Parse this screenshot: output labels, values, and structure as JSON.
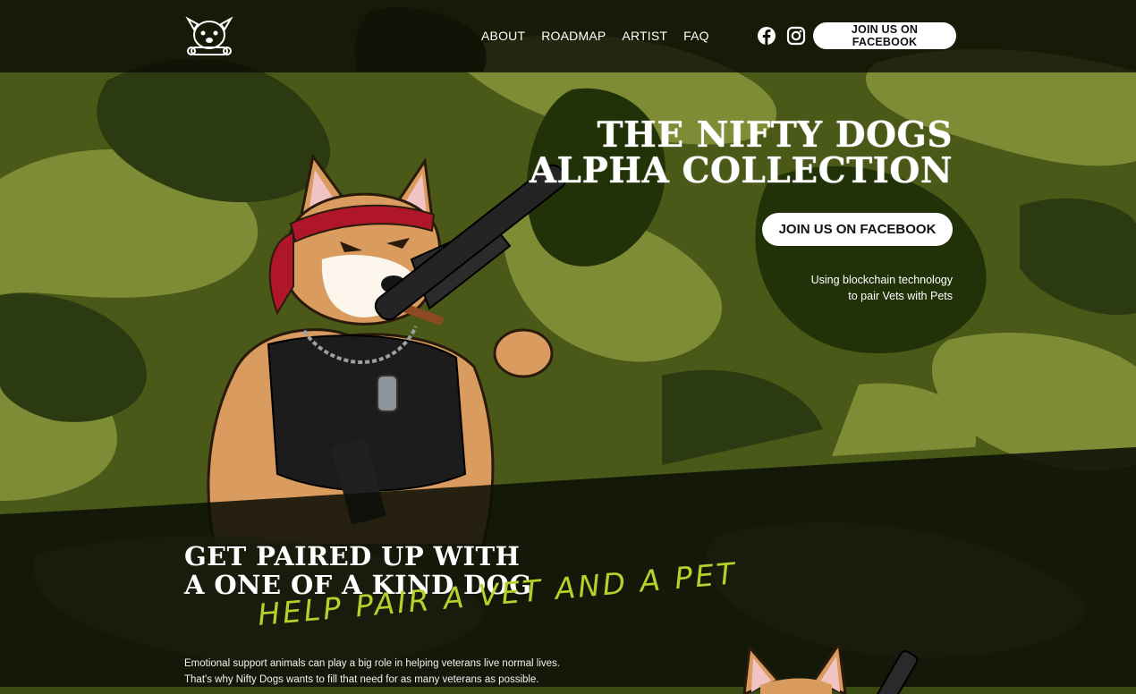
{
  "header": {
    "nav": [
      {
        "label": "ABOUT"
      },
      {
        "label": "ROADMAP"
      },
      {
        "label": "ARTIST"
      },
      {
        "label": "FAQ"
      }
    ],
    "join_button": "JOIN US ON FACEBOOK",
    "social_icons": [
      "facebook-icon",
      "instagram-icon"
    ]
  },
  "hero": {
    "title_line1": "THE NIFTY DOGS",
    "title_line2": "ALPHA COLLECTION",
    "button": "JOIN US ON FACEBOOK",
    "tagline_line1": "Using blockchain technology",
    "tagline_line2": "to pair Vets with Pets"
  },
  "section": {
    "title_line1": "GET PAIRED UP WITH",
    "title_line2": "A ONE OF A KIND DOG",
    "script": "HELP PAIR A VET AND A PET",
    "body_line1": "Emotional support animals can play a big role in helping veterans live normal lives.",
    "body_line2": "That's why Nifty Dogs wants to fill that need for as many veterans as possible."
  },
  "colors": {
    "accent_script": "#b9cf2a",
    "camo_light": "#7d8b34",
    "camo_mid": "#4f5c1c",
    "camo_dark": "#1e2a0c"
  }
}
